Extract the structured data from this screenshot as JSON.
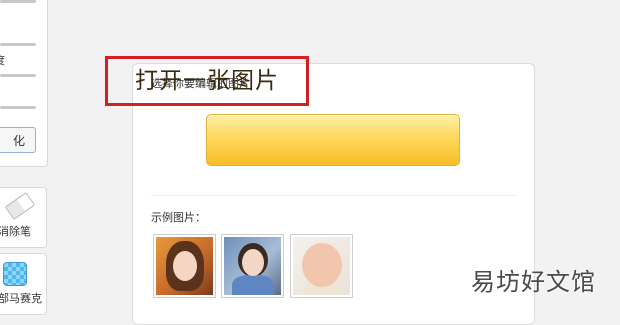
{
  "left_panel": {
    "slider_label_partial": "度",
    "apply_button_partial": "化",
    "tools": [
      {
        "label": "消除笔",
        "icon": "eraser-icon"
      },
      {
        "label": "部马赛克",
        "icon": "mosaic-icon"
      }
    ]
  },
  "card": {
    "title": "选择你要编辑的图片",
    "open_button": "打开一张图片",
    "sample_title": "示例图片："
  },
  "samples": [
    {
      "name": "woman-portrait"
    },
    {
      "name": "girl-selfie"
    },
    {
      "name": "baby-portrait"
    }
  ],
  "watermark": "易坊好文馆",
  "colors": {
    "button_top": "#fff0a8",
    "button_bottom": "#f6bd26",
    "highlight_box": "#d32023"
  }
}
